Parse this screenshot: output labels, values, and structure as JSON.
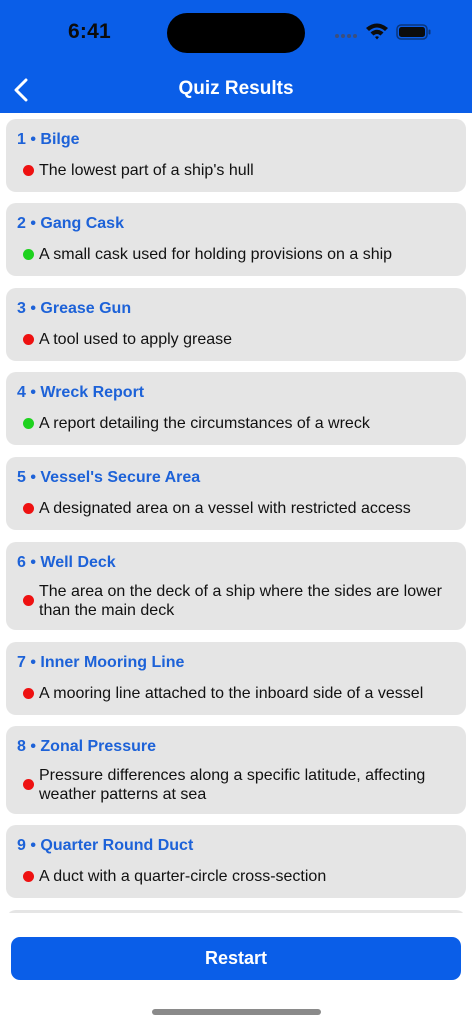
{
  "status_bar": {
    "time": "6:41"
  },
  "header": {
    "title": "Quiz Results",
    "back_icon": "chevron-left-icon"
  },
  "colors": {
    "accent": "#0a5ee8",
    "title_blue": "#1d62d8",
    "correct": "#1ed21e",
    "incorrect": "#ee1111",
    "card_bg": "#e5e5e5"
  },
  "results": [
    {
      "title": "1 • Bilge",
      "definition": "The lowest part of a ship's hull",
      "correct": false
    },
    {
      "title": "2 • Gang Cask",
      "definition": "A small cask used for holding provisions on a ship",
      "correct": true
    },
    {
      "title": "3 • Grease Gun",
      "definition": "A tool used to apply grease",
      "correct": false
    },
    {
      "title": "4 • Wreck Report",
      "definition": "A report detailing the circumstances of a wreck",
      "correct": true
    },
    {
      "title": "5 • Vessel's Secure Area",
      "definition": "A designated area on a vessel with restricted access",
      "correct": false
    },
    {
      "title": "6 • Well Deck",
      "definition": "The area on the deck of a ship where the sides are lower than the main deck",
      "correct": false
    },
    {
      "title": "7 • Inner Mooring Line",
      "definition": "A mooring line attached to the inboard side of a vessel",
      "correct": false
    },
    {
      "title": "8 • Zonal Pressure",
      "definition": "Pressure differences along a specific latitude, affecting weather patterns at sea",
      "correct": false
    },
    {
      "title": "9 • Quarter Round Duct",
      "definition": "A duct with a quarter-circle cross-section",
      "correct": false
    }
  ],
  "footer": {
    "restart_label": "Restart"
  }
}
